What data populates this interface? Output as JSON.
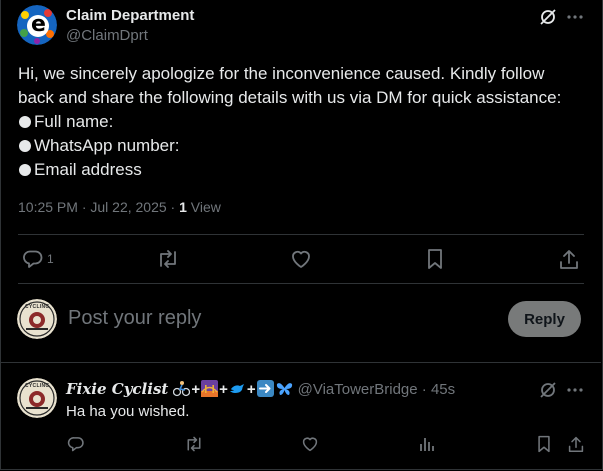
{
  "tweet": {
    "author_name": "Claim Department",
    "author_handle": "@ClaimDprt",
    "avatar_letter": "e",
    "text_line1": "Hi, we sincerely apologize for the inconvenience caused. Kindly follow",
    "text_line2": "back and share the following details with us via DM for quick assistance:",
    "bullets": [
      "Full name:",
      "WhatsApp number:",
      "Email address"
    ],
    "time": "10:25 PM · Jul 22, 2025 · ",
    "views_count": "1",
    "views_label": " View",
    "reply_count": "1"
  },
  "composer": {
    "placeholder": "Post your reply",
    "button_label": "Reply",
    "avatar_text": "CYCLING"
  },
  "reply": {
    "author_name": "Fixie Cyclist",
    "name_plus": "+",
    "handle_time": "@ViaTowerBridge · 45s",
    "text": "Ha ha you wished."
  },
  "colors": {
    "background": "#000000",
    "text": "#e7e9ea",
    "muted": "#71767b",
    "border": "#2f3336",
    "reply_button": "#787a7a",
    "brand_blue": "#1d9bf0"
  },
  "icons": [
    "grok-icon",
    "more-icon",
    "reply-icon",
    "retweet-icon",
    "like-icon",
    "bookmark-icon",
    "share-icon",
    "analytics-icon"
  ]
}
